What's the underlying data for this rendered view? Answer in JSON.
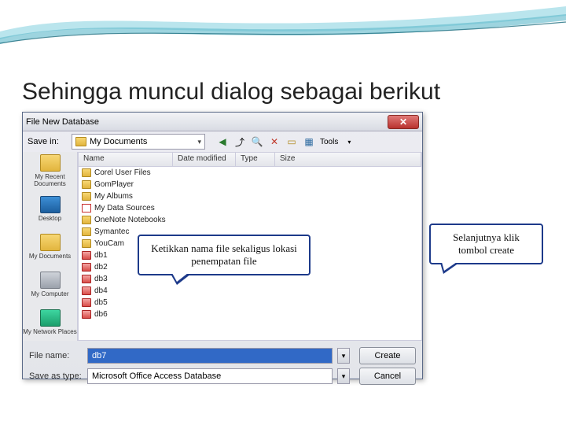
{
  "page": {
    "title": "Sehingga muncul dialog sebagai berikut"
  },
  "dialog": {
    "title": "File New Database",
    "savein_label": "Save in:",
    "savein_value": "My Documents",
    "tools_label": "Tools",
    "headers": {
      "name": "Name",
      "date": "Date modified",
      "type": "Type",
      "size": "Size"
    },
    "places": [
      {
        "label": "My Recent Documents",
        "cls": "ico-recent"
      },
      {
        "label": "Desktop",
        "cls": "ico-desktop"
      },
      {
        "label": "My Documents",
        "cls": "ico-docs"
      },
      {
        "label": "My Computer",
        "cls": "ico-comp"
      },
      {
        "label": "My Network Places",
        "cls": "ico-net"
      }
    ],
    "files": [
      {
        "name": "Corel User Files",
        "ico": "fico-folder"
      },
      {
        "name": "GomPlayer",
        "ico": "fico-folder"
      },
      {
        "name": "My Albums",
        "ico": "fico-folder"
      },
      {
        "name": "My Data Sources",
        "ico": "fico-ds"
      },
      {
        "name": "OneNote Notebooks",
        "ico": "fico-folder"
      },
      {
        "name": "Symantec",
        "ico": "fico-folder"
      },
      {
        "name": "YouCam",
        "ico": "fico-folder"
      },
      {
        "name": "db1",
        "ico": "fico-db"
      },
      {
        "name": "db2",
        "ico": "fico-db"
      },
      {
        "name": "db3",
        "ico": "fico-db"
      },
      {
        "name": "db4",
        "ico": "fico-db"
      },
      {
        "name": "db5",
        "ico": "fico-db"
      },
      {
        "name": "db6",
        "ico": "fico-db"
      }
    ],
    "filename_label": "File name:",
    "filename_value": "db7",
    "type_label": "Save as type:",
    "type_value": "Microsoft Office Access Database",
    "create_label": "Create",
    "cancel_label": "Cancel"
  },
  "callouts": {
    "c1": "Ketikkan nama file sekaligus lokasi penempatan file",
    "c2": "Selanjutnya klik tombol create"
  }
}
